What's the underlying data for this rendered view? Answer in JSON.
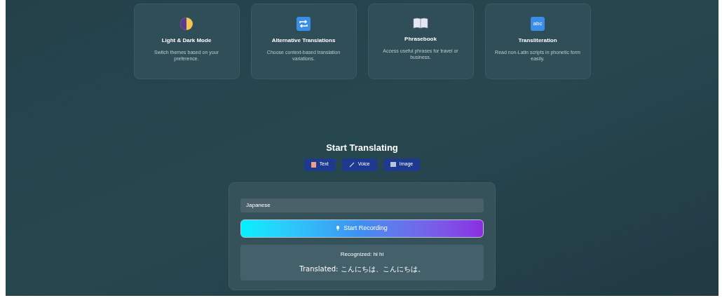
{
  "features": [
    {
      "kind": "theme",
      "title": "Light & Dark Mode",
      "description": "Switch themes based on your preference."
    },
    {
      "kind": "repeat",
      "title": "Alternative Translations",
      "description": "Choose context-based translation variations."
    },
    {
      "kind": "book",
      "title": "Phrasebook",
      "description": "Access useful phrases for travel or business."
    },
    {
      "kind": "abc",
      "title": "Transliteration",
      "description": "Read non-Latin scripts in phonetic form easily.",
      "icon_text": "abc"
    }
  ],
  "section_title": "Start Translating",
  "modes": [
    {
      "kind": "text",
      "label": "Text"
    },
    {
      "kind": "voice",
      "label": "Voice"
    },
    {
      "kind": "image",
      "label": "Image"
    }
  ],
  "language_field": {
    "value": "Japanese"
  },
  "record_button": {
    "label": "Start Recording"
  },
  "result": {
    "recognized": "Recognized: hi hi",
    "translated": "Translated: こんにちは、こんにちは。"
  }
}
